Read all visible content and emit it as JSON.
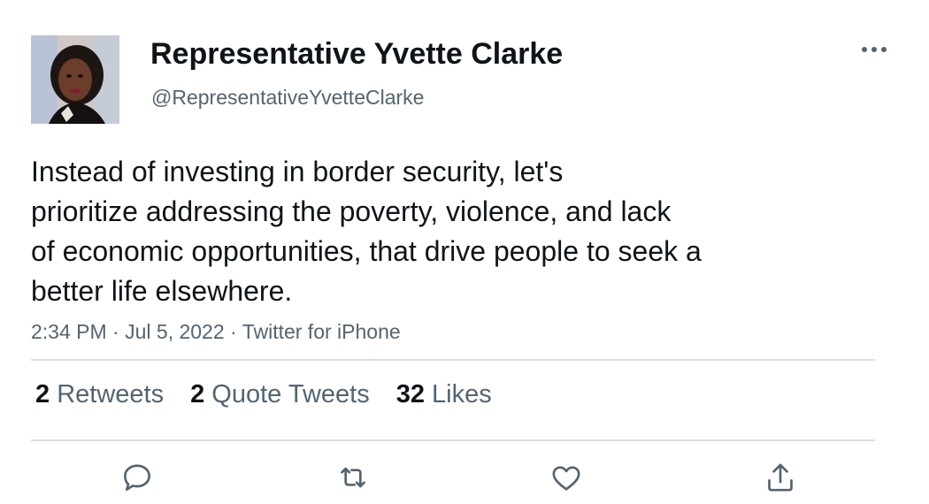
{
  "author": {
    "display_name": "Representative Yvette Clarke",
    "handle": "@RepresentativeYvetteClarke"
  },
  "tweet": {
    "lines": [
      "Instead of investing in border security, let's",
      "prioritize addressing the poverty, violence, and lack",
      "of economic opportunities, that drive people to seek a",
      "better life elsewhere."
    ],
    "time": "2:34 PM",
    "date": "Jul 5, 2022",
    "source": "Twitter for iPhone",
    "separator": "·"
  },
  "stats": {
    "retweets": {
      "count": "2",
      "label": "Retweets"
    },
    "quotes": {
      "count": "2",
      "label": "Quote Tweets"
    },
    "likes": {
      "count": "32",
      "label": "Likes"
    }
  },
  "actions": [
    "reply-icon",
    "retweet-icon",
    "like-icon",
    "share-icon"
  ],
  "colors": {
    "text": "#0f1419",
    "secondary": "#536471",
    "divider": "#dcdfe2"
  }
}
